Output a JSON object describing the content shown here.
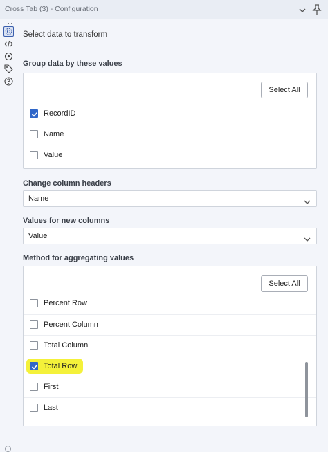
{
  "window": {
    "title": "Cross Tab (3) - Configuration"
  },
  "rail": {
    "icons": [
      "gear-icon",
      "code-icon",
      "target-icon",
      "tag-icon",
      "help-icon"
    ]
  },
  "main": {
    "intro": "Select data to transform",
    "group_by": {
      "title": "Group data by these values",
      "select_all": "Select All",
      "items": [
        {
          "label": "RecordID",
          "checked": true
        },
        {
          "label": "Name",
          "checked": false
        },
        {
          "label": "Value",
          "checked": false
        }
      ]
    },
    "headers": {
      "title": "Change column headers",
      "value": "Name"
    },
    "values": {
      "title": "Values for new columns",
      "value": "Value"
    },
    "method": {
      "title": "Method for aggregating values",
      "select_all": "Select All",
      "items": [
        {
          "label": "Percent Row",
          "checked": false
        },
        {
          "label": "Percent Column",
          "checked": false
        },
        {
          "label": "Total Column",
          "checked": false
        },
        {
          "label": "Total Row",
          "checked": true
        },
        {
          "label": "First",
          "checked": false
        },
        {
          "label": "Last",
          "checked": false
        }
      ]
    }
  },
  "colors": {
    "accent": "#2f66c8",
    "highlight": "#f4f13a"
  }
}
